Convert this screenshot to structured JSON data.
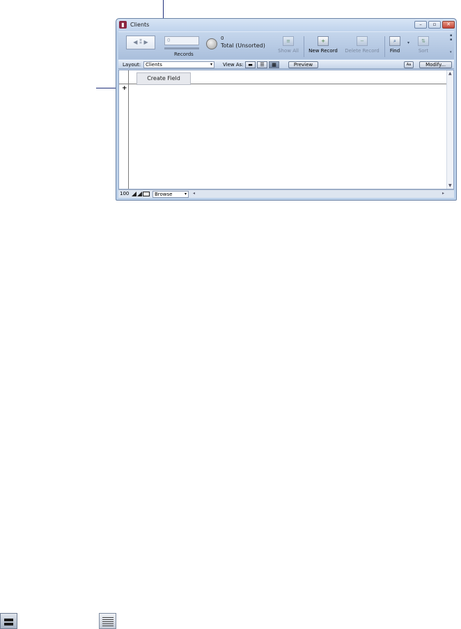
{
  "window": {
    "title": "Clients",
    "controls": {
      "minimize": "–",
      "maximize": "▫",
      "close": "✕"
    }
  },
  "status_toolbar": {
    "current_record": "0",
    "records_label": "Records",
    "found_count": "0",
    "total_label": "Total (Unsorted)",
    "buttons": {
      "show_all": "Show All",
      "new_record": "New Record",
      "delete_record": "Delete Record",
      "find": "Find",
      "sort": "Sort"
    }
  },
  "layout_bar": {
    "layout_label": "Layout:",
    "layout_value": "Clients",
    "view_as_label": "View As:",
    "preview_label": "Preview",
    "modify_label": "Modify..."
  },
  "content": {
    "create_field_label": "Create Field",
    "add_record_symbol": "+"
  },
  "bottom_bar": {
    "zoom_level": "100",
    "mode_value": "Browse"
  }
}
